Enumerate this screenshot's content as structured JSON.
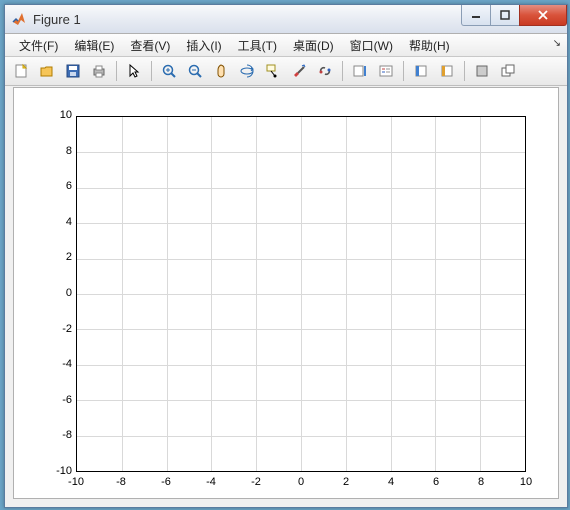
{
  "window": {
    "title": "Figure 1"
  },
  "menu": {
    "file": "文件(F)",
    "edit": "编辑(E)",
    "view": "查看(V)",
    "insert": "插入(I)",
    "tools": "工具(T)",
    "desktop": "桌面(D)",
    "window": "窗口(W)",
    "help": "帮助(H)"
  },
  "chart_data": {
    "type": "line",
    "series": [],
    "title": "",
    "xlabel": "",
    "ylabel": "",
    "xlim": [
      -10,
      10
    ],
    "ylim": [
      -10,
      10
    ],
    "xticks": [
      -10,
      -8,
      -6,
      -4,
      -2,
      0,
      2,
      4,
      6,
      8,
      10
    ],
    "yticks": [
      -10,
      -8,
      -6,
      -4,
      -2,
      0,
      2,
      4,
      6,
      8,
      10
    ],
    "grid": true
  },
  "xticklabels": {
    "t0": "-10",
    "t1": "-8",
    "t2": "-6",
    "t3": "-4",
    "t4": "-2",
    "t5": "0",
    "t6": "2",
    "t7": "4",
    "t8": "6",
    "t9": "8",
    "t10": "10"
  },
  "yticklabels": {
    "t0": "-10",
    "t1": "-8",
    "t2": "-6",
    "t3": "-4",
    "t4": "-2",
    "t5": "0",
    "t6": "2",
    "t7": "4",
    "t8": "6",
    "t9": "8",
    "t10": "10"
  }
}
